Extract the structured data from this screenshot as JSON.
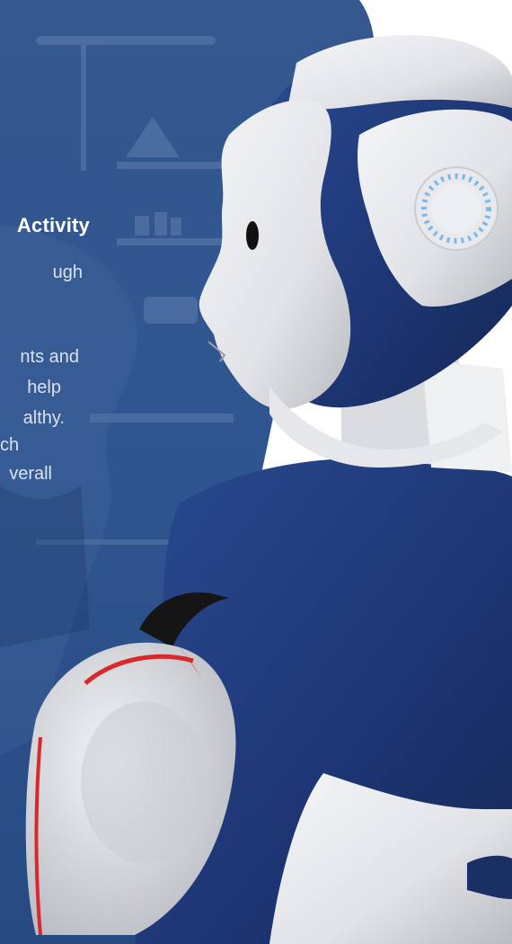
{
  "hero": {
    "heading_fragment": "Activity",
    "body_lines": [
      "ugh",
      "",
      "nts and",
      "help",
      "althy.",
      "ch",
      "verall"
    ]
  },
  "colors": {
    "panel_blue": "#2b4f86",
    "panel_overlay": "#3a5f95",
    "robot_navy": "#1f3a7a",
    "robot_shell": "#e8e9ec",
    "accent_red": "#d8282b",
    "led_ring": "#7fb8e6"
  }
}
